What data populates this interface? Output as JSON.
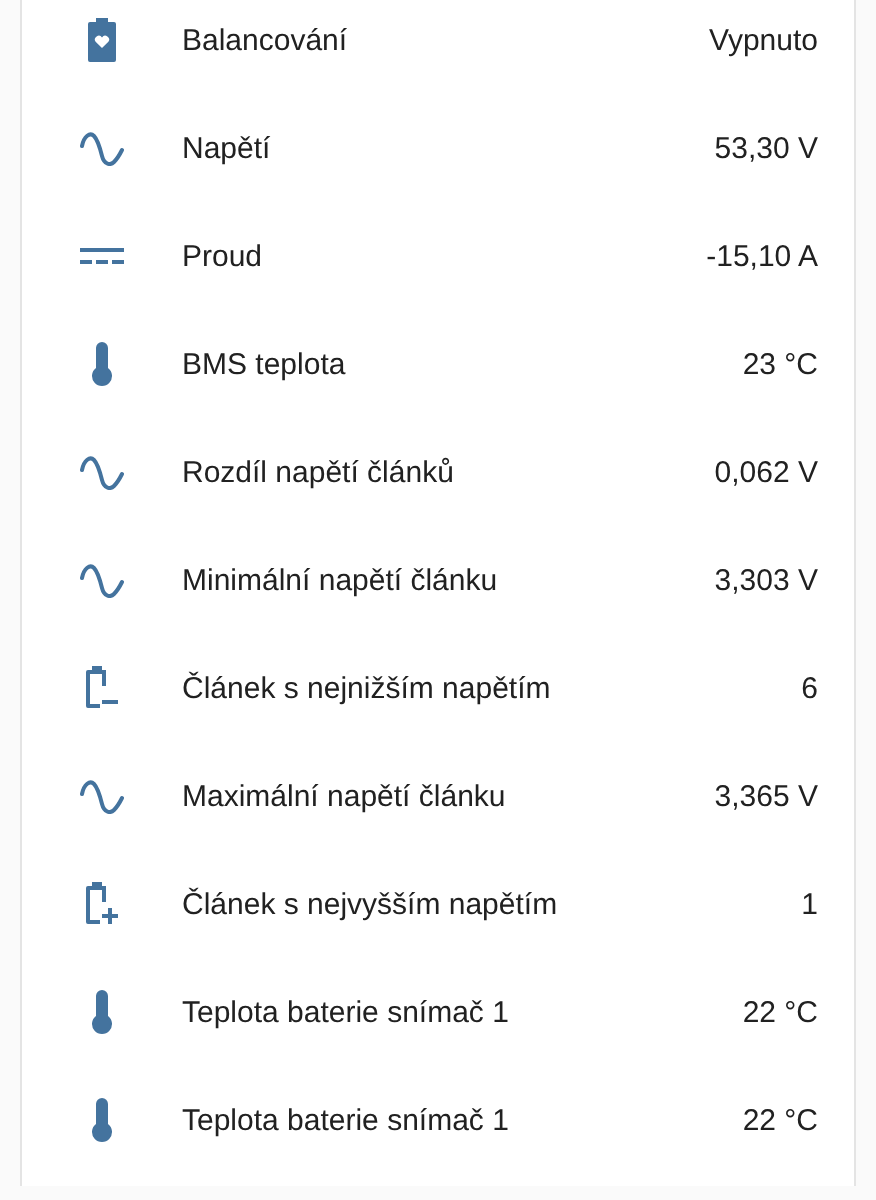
{
  "rows": [
    {
      "kind": "balancing",
      "label": "Balancování",
      "value": "Vypnuto"
    },
    {
      "kind": "voltage",
      "label": "Napětí",
      "value": "53,30 V"
    },
    {
      "kind": "current",
      "label": "Proud",
      "value": "-15,10 A"
    },
    {
      "kind": "temperature",
      "label": "BMS teplota",
      "value": "23 °C"
    },
    {
      "kind": "voltage",
      "label": "Rozdíl napětí článků",
      "value": "0,062 V"
    },
    {
      "kind": "voltage",
      "label": "Minimální napětí článku",
      "value": "3,303 V"
    },
    {
      "kind": "lowcell",
      "label": "Článek s nejnižším napětím",
      "value": "6"
    },
    {
      "kind": "voltage",
      "label": "Maximální napětí článku",
      "value": "3,365 V"
    },
    {
      "kind": "highcell",
      "label": "Článek s nejvyšším napětím",
      "value": "1"
    },
    {
      "kind": "temperature",
      "label": "Teplota baterie snímač 1",
      "value": "22 °C"
    },
    {
      "kind": "temperature",
      "label": "Teplota baterie snímač 1",
      "value": "22 °C"
    }
  ]
}
